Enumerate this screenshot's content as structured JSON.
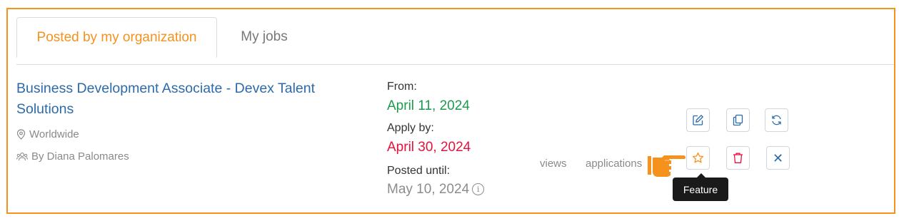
{
  "tabs": [
    {
      "label": "Posted by my organization",
      "active": true
    },
    {
      "label": "My jobs",
      "active": false
    }
  ],
  "job": {
    "title": "Business Development Associate - Devex Talent Solutions",
    "location": "Worldwide",
    "author": "By Diana Palomares",
    "from_label": "From:",
    "from_date": "April 11, 2024",
    "apply_label": "Apply by:",
    "apply_date": "April 30, 2024",
    "posted_label": "Posted until:",
    "posted_date": "May 10, 2024",
    "views_label": "views",
    "applications_label": "applications"
  },
  "actions": {
    "edit_icon": "edit-icon",
    "copy_icon": "copy-icon",
    "refresh_icon": "refresh-icon",
    "feature_icon": "star-icon",
    "delete_icon": "trash-icon",
    "close_label": "✕"
  },
  "tooltip": {
    "text": "Feature"
  },
  "colors": {
    "accent": "#f5921e",
    "link": "#2c6aa8",
    "from_date": "#1e9a4e",
    "apply_date": "#e4123d",
    "posted_date": "#8c8c8c"
  }
}
